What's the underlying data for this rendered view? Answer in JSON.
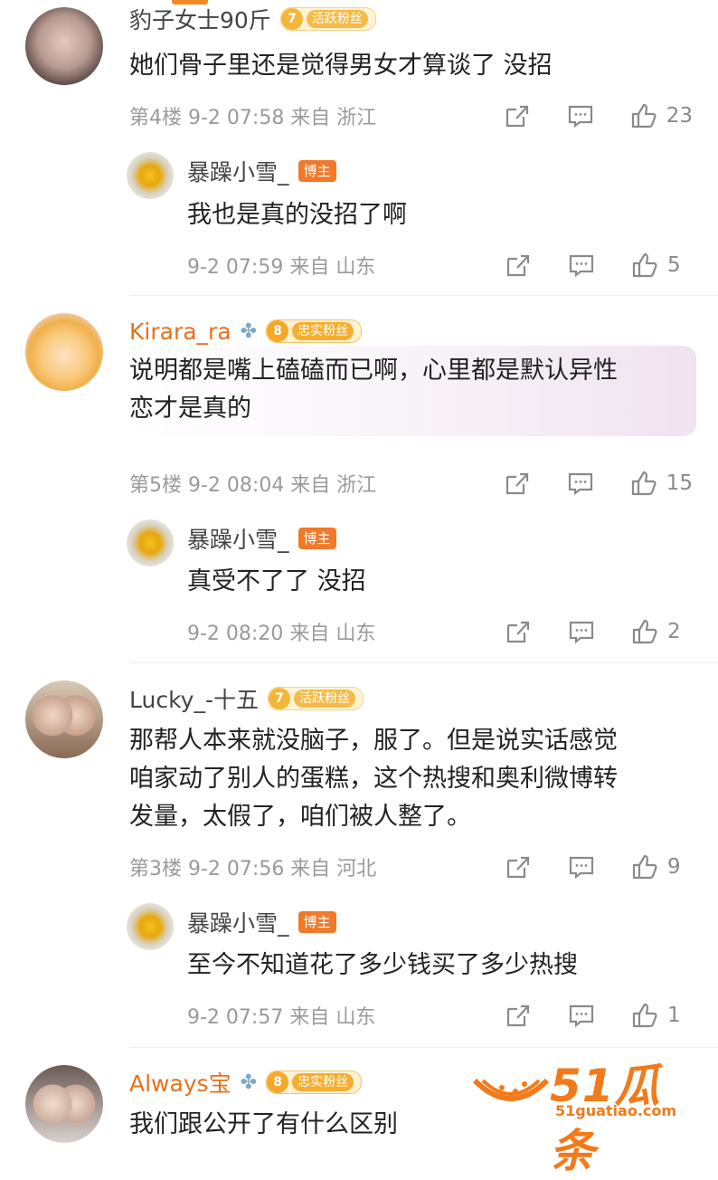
{
  "comments": [
    {
      "name": "豹子女士90斤",
      "badge": {
        "level": "7",
        "label": "活跃粉丝"
      },
      "text_lines": [
        "她们骨子里还是觉得男女才算谈了 没招"
      ],
      "meta": "第4楼 9-2 07:58 来自 浙江",
      "likes": "23",
      "reply": {
        "name": "暴躁小雪_",
        "owner_label": "博主",
        "text": "我也是真的没招了啊",
        "meta": "9-2 07:59 来自 山东",
        "likes": "5"
      }
    },
    {
      "name": "Kirara_ra",
      "badge": {
        "level": "8",
        "label": "忠实粉丝"
      },
      "text_lines": [
        "说明都是嘴上磕磕而已啊，心里都是默认异性",
        "恋才是真的"
      ],
      "meta": "第5楼 9-2 08:04 来自 浙江",
      "likes": "15",
      "reply": {
        "name": "暴躁小雪_",
        "owner_label": "博主",
        "text": "真受不了了 没招",
        "meta": "9-2 08:20 来自 山东",
        "likes": "2"
      }
    },
    {
      "name": "Lucky_-十五",
      "badge": {
        "level": "7",
        "label": "活跃粉丝"
      },
      "text_lines": [
        "那帮人本来就没脑子，服了。但是说实话感觉",
        "咱家动了别人的蛋糕，这个热搜和奥利微博转",
        "发量，太假了，咱们被人整了。"
      ],
      "meta": "第3楼 9-2 07:56 来自 河北",
      "likes": "9",
      "reply": {
        "name": "暴躁小雪_",
        "owner_label": "博主",
        "text": "至今不知道花了多少钱买了多少热搜",
        "meta": "9-2 07:57 来自 山东",
        "likes": "1"
      }
    },
    {
      "name": "Always宝",
      "badge": {
        "level": "8",
        "label": "忠实粉丝"
      },
      "text_lines": [
        "我们跟公开了有什么区别"
      ]
    }
  ],
  "watermark": {
    "title": "51瓜条",
    "url": "51guatiao.com"
  },
  "colors": {
    "accent": "#f08a24",
    "owner": "#f0792a",
    "name_orange": "#e8701a"
  }
}
